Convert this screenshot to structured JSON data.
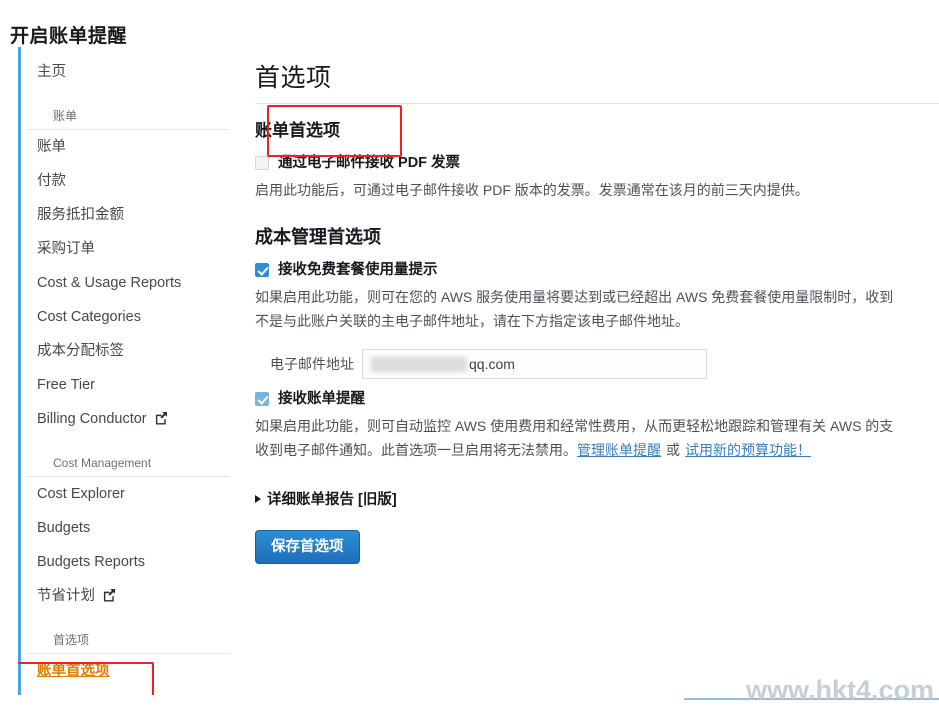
{
  "annotation": {
    "title": "开启账单提醒",
    "highlight_color": "#ee2222"
  },
  "sidebar": {
    "items": [
      {
        "label": "主页",
        "type": "link"
      },
      {
        "label": "账单",
        "type": "group"
      },
      {
        "label": "账单",
        "type": "link"
      },
      {
        "label": "付款",
        "type": "link"
      },
      {
        "label": "服务抵扣金额",
        "type": "link"
      },
      {
        "label": "采购订单",
        "type": "link"
      },
      {
        "label": "Cost & Usage Reports",
        "type": "link"
      },
      {
        "label": "Cost Categories",
        "type": "link"
      },
      {
        "label": "成本分配标签",
        "type": "link"
      },
      {
        "label": "Free Tier",
        "type": "link"
      },
      {
        "label": "Billing Conductor",
        "type": "extlink",
        "icon": "external-link-icon"
      },
      {
        "label": "Cost Management",
        "type": "group"
      },
      {
        "label": "Cost Explorer",
        "type": "link"
      },
      {
        "label": "Budgets",
        "type": "link"
      },
      {
        "label": "Budgets Reports",
        "type": "link"
      },
      {
        "label": "节省计划",
        "type": "extlink",
        "icon": "external-link-icon"
      },
      {
        "label": "首选项",
        "type": "group"
      },
      {
        "label": "账单首选项",
        "type": "link",
        "active": true
      }
    ],
    "active_color": "#e07c00",
    "accent_border": "#4ba3e3"
  },
  "main": {
    "page_title": "首选项",
    "billing_section": {
      "heading": "账单首选项",
      "pdf_invoice": {
        "label": "通过电子邮件接收 PDF 发票",
        "checked": false,
        "description": "启用此功能后，可通过电子邮件接收 PDF 版本的发票。发票通常在该月的前三天内提供。"
      }
    },
    "cost_section": {
      "heading": "成本管理首选项",
      "free_tier_alert": {
        "label": "接收免费套餐使用量提示",
        "checked": true,
        "description_line1": "如果启用此功能，则可在您的 AWS 服务使用量将要达到或已经超出 AWS 免费套餐使用量限制时，收到",
        "description_line2": "不是与此账户关联的主电子邮件地址，请在下方指定该电子邮件地址。",
        "email_label": "电子邮件地址",
        "email_value": "qq.com",
        "email_redacted": true
      },
      "billing_alerts": {
        "label": "接收账单提醒",
        "checked": true,
        "description_line1": "如果启用此功能，则可自动监控 AWS 使用费用和经常性费用，从而更轻松地跟踪和管理有关 AWS 的支",
        "description_line2_prefix": "收到电子邮件通知。此首选项一旦启用将无法禁用。",
        "link_manage": "管理账单提醒",
        "link_separator": "或",
        "link_budgets": "试用新的预算功能！"
      }
    },
    "detailed_report": {
      "label": "详细账单报告 [旧版]",
      "expanded": false
    },
    "save_button": "保存首选项"
  },
  "watermark": {
    "text": "www.hkt4.com"
  }
}
